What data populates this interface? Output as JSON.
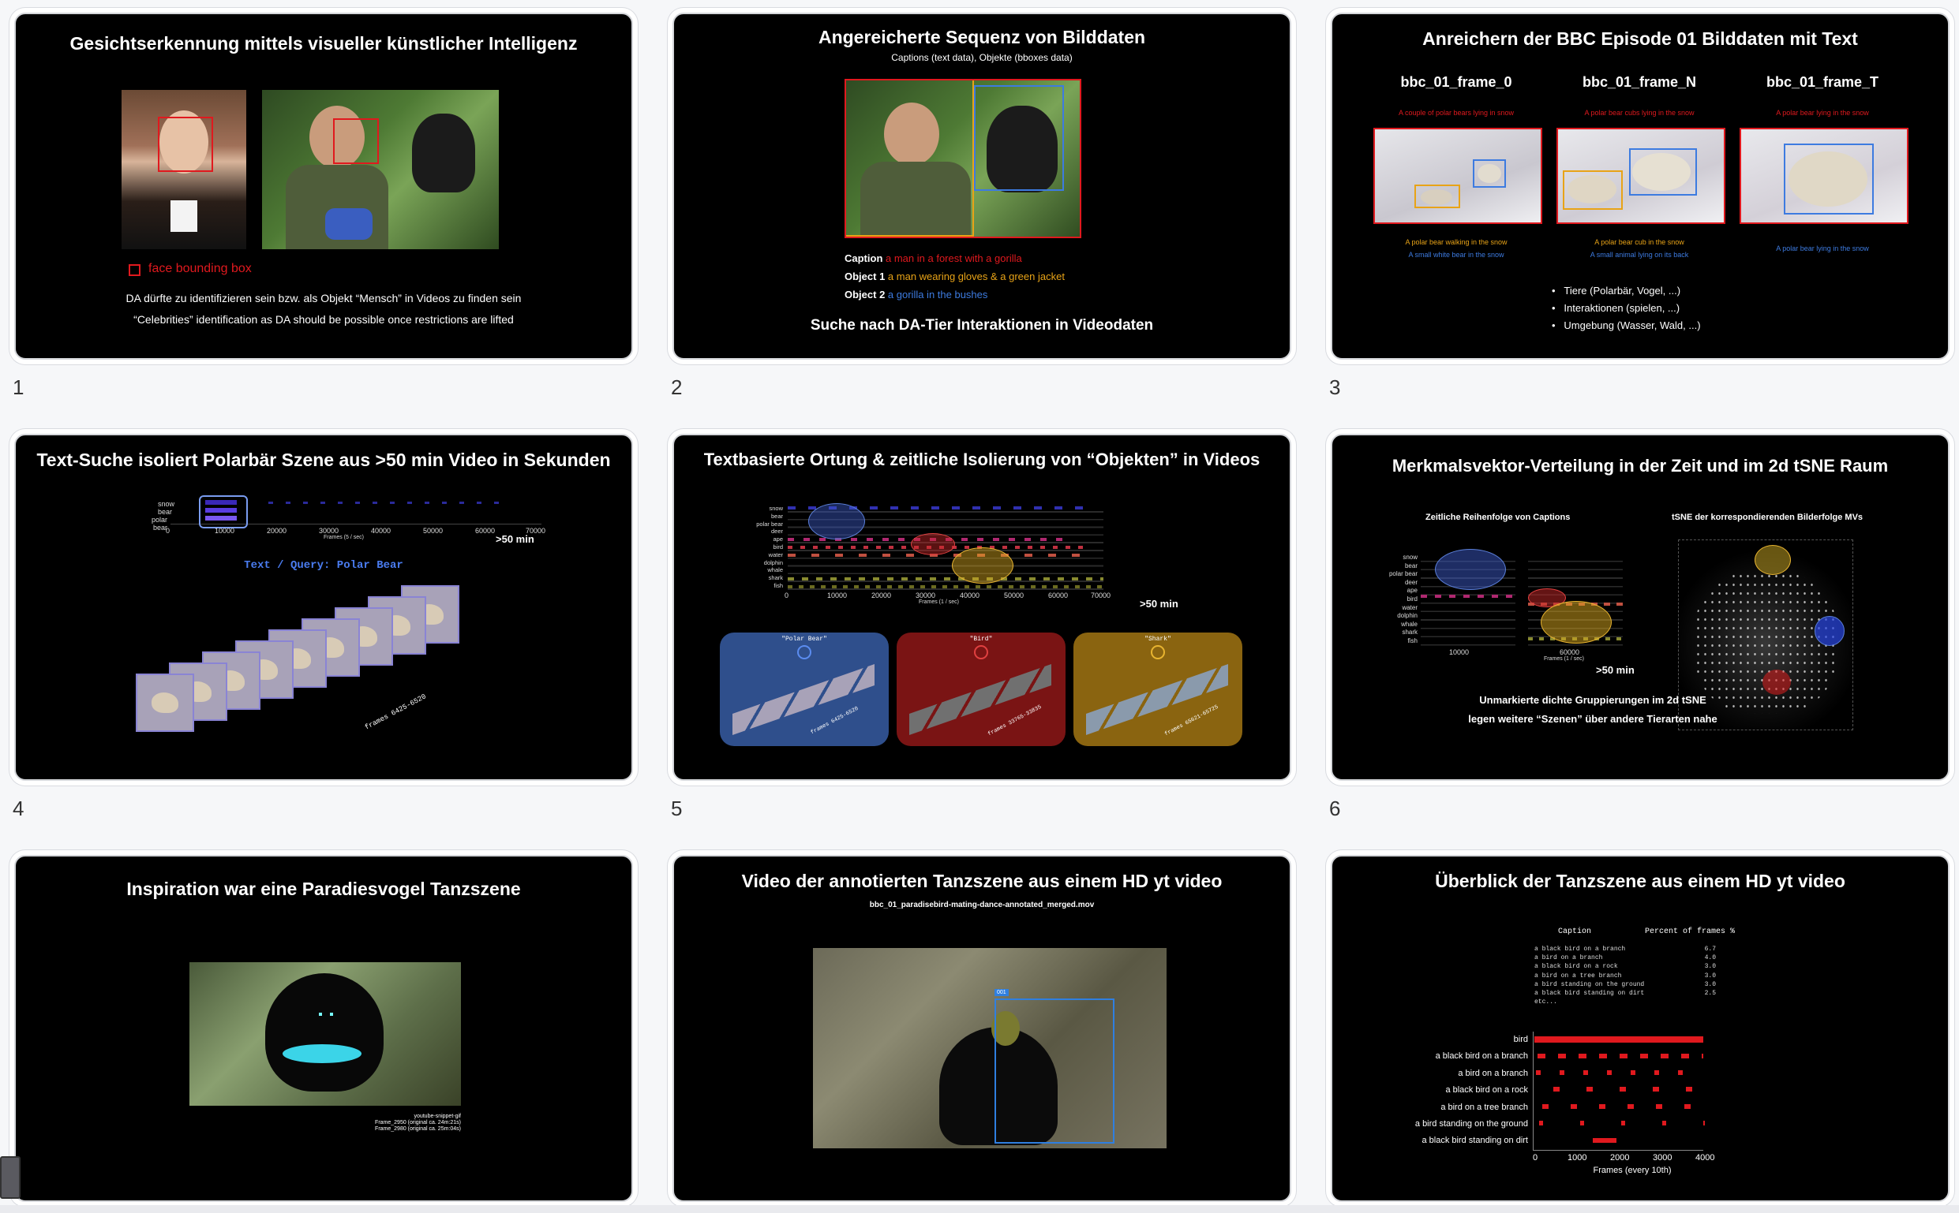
{
  "slide_numbers": [
    "1",
    "2",
    "3",
    "4",
    "5",
    "6",
    "7",
    "8",
    "9"
  ],
  "s1": {
    "title": "Gesichtserkennung mittels visueller künstlicher Intelligenz",
    "legend": "face bounding box",
    "line1": "DA dürfte zu identifizieren sein bzw. als Objekt “Mensch” in Videos zu finden sein",
    "line2": "“Celebrities” identification as DA should be possible once restrictions are lifted",
    "colors": {
      "face_box": "#e0191e"
    }
  },
  "s2": {
    "title": "Angereicherte Sequenz von Bilddaten",
    "subtitle": "Captions (text data), Objekte (bboxes data)",
    "caption_label": "Caption",
    "caption_text": "a man in a forest with a gorilla",
    "obj1_label": "Object 1",
    "obj1_text": "a man wearing gloves & a green jacket",
    "obj2_label": "Object 2",
    "obj2_text": "a gorilla in the bushes",
    "footer": "Suche nach DA-Tier Interaktionen in Videodaten",
    "colors": {
      "caption": "#e0191e",
      "obj1": "#e8a317",
      "obj2": "#3d7be0"
    }
  },
  "s3": {
    "title": "Anreichern der BBC Episode 01 Bilddaten mit Text",
    "frames": [
      {
        "name": "bbc_01_frame_0",
        "caption": "A couple of polar bears lying in snow",
        "obj1": "A polar bear walking in the snow",
        "obj2": "A small white bear in the snow"
      },
      {
        "name": "bbc_01_frame_N",
        "caption": "A polar bear cubs lying in the snow",
        "obj1": "A polar bear cub in the snow",
        "obj2": "A small animal lying on its back"
      },
      {
        "name": "bbc_01_frame_T",
        "caption": "A polar bear lying in the snow",
        "obj1": "",
        "obj2": "A polar bear lying in the snow"
      }
    ],
    "bullets": [
      "Tiere (Polarbär, Vogel, ...)",
      "Interaktionen (spielen, ...)",
      "Umgebung (Wasser, Wald, ...)"
    ]
  },
  "s4": {
    "title_pre": "Text-Suche isoliert Polarbär Szene aus ",
    "title_bold": ">50 min",
    "title_post": " Video in Sekunden",
    "query": "Text / Query: Polar Bear",
    "duration": ">50 min",
    "y_labels": [
      "snow",
      "bear",
      "polar bear"
    ],
    "x_ticks": [
      "0",
      "10000",
      "20000",
      "30000",
      "40000",
      "50000",
      "60000",
      "70000"
    ],
    "x_label": "Frames (5 / sec)",
    "frames_label": "frames 6425-6520"
  },
  "s5": {
    "title": "Textbasierte Ortung & zeitliche Isolierung von “Objekten” in Videos",
    "y_labels": [
      "snow",
      "bear",
      "polar bear",
      "deer",
      "ape",
      "bird",
      "water",
      "dolphin",
      "whale",
      "shark",
      "fish"
    ],
    "x_ticks": [
      "0",
      "10000",
      "20000",
      "30000",
      "40000",
      "50000",
      "60000",
      "70000"
    ],
    "x_label": "Frames (1 / sec)",
    "duration": ">50 min",
    "panels": [
      {
        "label": "\"Polar Bear\"",
        "frames": "frames 6425-6520",
        "color": "#2f4f8c"
      },
      {
        "label": "\"Bird\"",
        "frames": "frames 33765-33835",
        "color": "#7a1414"
      },
      {
        "label": "\"Shark\"",
        "frames": "frames 65621-65725",
        "color": "#8a6410"
      }
    ]
  },
  "s6": {
    "title": "Merkmalsvektor-Verteilung in der Zeit und im 2d tSNE Raum",
    "left_heading": "Zeitliche Reihenfolge von Captions",
    "right_heading": "tSNE der korrespondierenden Bilderfolge MVs",
    "y_labels": [
      "snow",
      "bear",
      "polar bear",
      "deer",
      "ape",
      "bird",
      "water",
      "dolphin",
      "whale",
      "shark",
      "fish"
    ],
    "x_tick_left": "10000",
    "x_tick_right": "60000",
    "x_label": "Frames (1 / sec)",
    "duration": ">50 min",
    "note1": "Unmarkierte dichte Gruppierungen im 2d tSNE",
    "note2": "legen weitere “Szenen” über andere Tierarten nahe"
  },
  "s7": {
    "title": "Inspiration war eine Paradiesvogel Tanzszene",
    "credit1": "youtube-snippet-gif",
    "credit2": "Frame_2950 (original ca. 24m:21s)",
    "credit3": "Frame_2980 (original ca. 25m:04s)"
  },
  "s8": {
    "title": "Video der annotierten Tanzszene aus einem HD yt video",
    "filename": "bbc_01_paradisebird-mating-dance-annotated_merged.mov",
    "box_tag": "001"
  },
  "s9": {
    "title": "Überblick der Tanzszene aus einem HD yt video",
    "table_head_caption": "Caption",
    "table_head_percent": "Percent of frames %",
    "table_rows": [
      {
        "caption": "a black bird on a branch",
        "percent": "6.7"
      },
      {
        "caption": "a bird on a branch",
        "percent": "4.0"
      },
      {
        "caption": "a black bird on a rock",
        "percent": "3.0"
      },
      {
        "caption": "a bird on a tree branch",
        "percent": "3.0"
      },
      {
        "caption": "a bird standing on the ground",
        "percent": "3.0"
      },
      {
        "caption": "a black bird standing on dirt",
        "percent": "2.5"
      }
    ],
    "table_etc": "etc...",
    "chart_labels": [
      "bird",
      "a black bird on a branch",
      "a bird on a branch",
      "a black bird on a rock",
      "a bird on a tree branch",
      "a bird standing on the ground",
      "a black bird standing on dirt"
    ],
    "x_ticks": [
      "0",
      "1000",
      "2000",
      "3000",
      "4000"
    ],
    "x_label": "Frames (every 10th)",
    "mark_color": "#e0191e"
  }
}
